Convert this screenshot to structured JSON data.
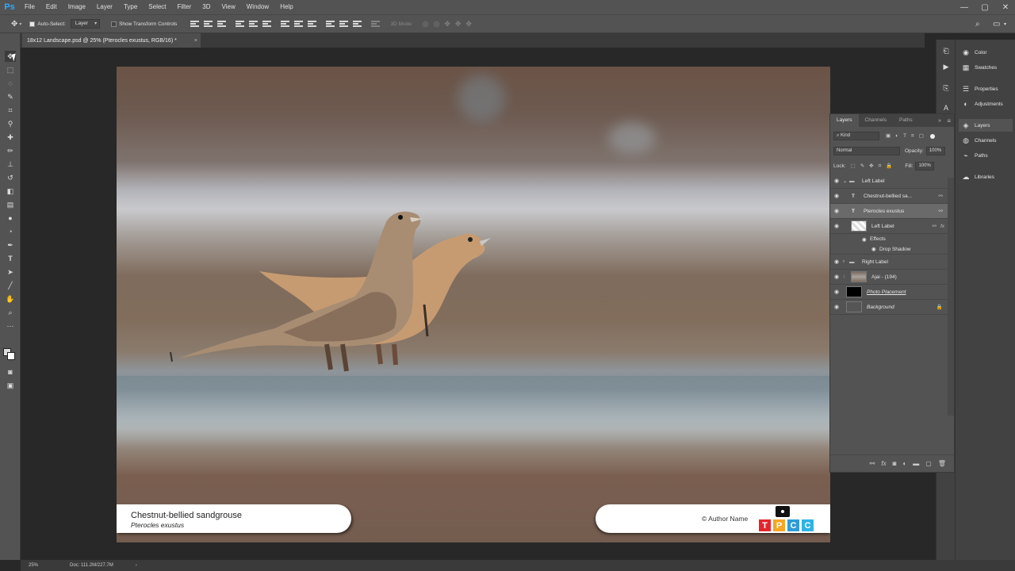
{
  "app": {
    "logo": "Ps",
    "accent": "#31a8ff"
  },
  "menu": [
    "File",
    "Edit",
    "Image",
    "Layer",
    "Type",
    "Select",
    "Filter",
    "3D",
    "View",
    "Window",
    "Help"
  ],
  "window_controls": {
    "minimize": "—",
    "restore": "▢",
    "close": "✕"
  },
  "options": {
    "auto_select_label": "Auto-Select:",
    "auto_select_value": "Layer",
    "show_transform_label": "Show Transform Controls",
    "mode_3d_label": "3D Mode:"
  },
  "document_tab": {
    "title": "18x12 Landscape.psd @ 25% (Pterocles exustus, RGB/16) *",
    "close": "×"
  },
  "photo": {
    "common_name": "Chestnut-bellied sandgrouse",
    "scientific_name": "Pterocles exustus",
    "author": "© Author Name",
    "logo_letters": [
      "T",
      "P",
      "C",
      "C"
    ],
    "logo_colors": [
      "#e3262d",
      "#f5a623",
      "#2f9bd6",
      "#2fb3e3"
    ]
  },
  "dock_right": [
    {
      "label": "Color",
      "icon": "color-wheel-icon"
    },
    {
      "label": "Swatches",
      "icon": "swatches-grid-icon"
    },
    {
      "label": "Properties",
      "icon": "properties-icon"
    },
    {
      "label": "Adjustments",
      "icon": "adjustments-icon"
    },
    {
      "label": "Layers",
      "icon": "layers-icon"
    },
    {
      "label": "Channels",
      "icon": "channels-icon"
    },
    {
      "label": "Paths",
      "icon": "paths-icon"
    },
    {
      "label": "Libraries",
      "icon": "libraries-icon"
    }
  ],
  "layers_panel": {
    "tabs": [
      "Layers",
      "Channels",
      "Paths"
    ],
    "filter_kind": "Kind",
    "blend_mode": "Normal",
    "opacity_label": "Opacity:",
    "opacity_value": "100%",
    "lock_label": "Lock:",
    "fill_label": "Fill:",
    "fill_value": "100%",
    "layers": [
      {
        "name": "Left Label",
        "type": "group"
      },
      {
        "name": "Chestnut-bellied sa...",
        "type": "text"
      },
      {
        "name": "Pterocles exustus",
        "type": "text"
      },
      {
        "name": "Left Label",
        "type": "layer"
      },
      {
        "name": "Effects",
        "type": "effects"
      },
      {
        "name": "Drop Shadow",
        "type": "effect"
      },
      {
        "name": "Right Label",
        "type": "group"
      },
      {
        "name": "Ajai - (194)",
        "type": "smart"
      },
      {
        "name": "Photo Placement",
        "type": "layer"
      },
      {
        "name": "Background",
        "type": "background"
      }
    ]
  },
  "status": {
    "zoom": "25%",
    "doc": "Doc: 111.2M/227.7M"
  }
}
